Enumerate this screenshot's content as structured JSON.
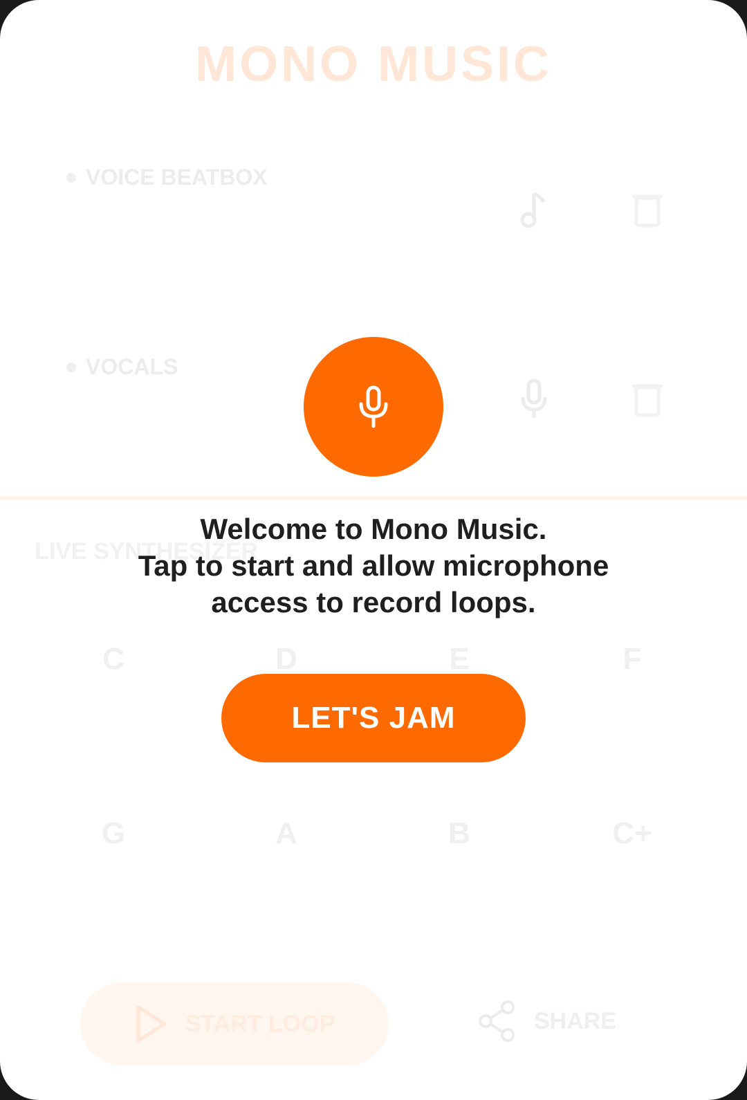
{
  "app": {
    "title": "MONO MUSIC"
  },
  "tracks": [
    {
      "label": "VOICE BEATBOX",
      "action_icon": "music-note-icon",
      "delete_icon": "trash-icon"
    },
    {
      "label": "VOCALS",
      "action_icon": "microphone-icon",
      "delete_icon": "trash-icon"
    }
  ],
  "synth": {
    "label": "LIVE SYNTHESIZER",
    "keys_row1": [
      "C",
      "D",
      "E",
      "F"
    ],
    "keys_row2": [
      "G",
      "A",
      "B",
      "C+"
    ]
  },
  "footer": {
    "start_loop_label": "START LOOP",
    "share_label": "SHARE"
  },
  "modal": {
    "icon": "microphone-icon",
    "line1": "Welcome to Mono Music.",
    "line2": "Tap to start and allow microphone",
    "line3": "access to record loops.",
    "button_label": "LET'S JAM"
  },
  "colors": {
    "accent": "#ff6a00",
    "text": "#1f1f1f"
  }
}
